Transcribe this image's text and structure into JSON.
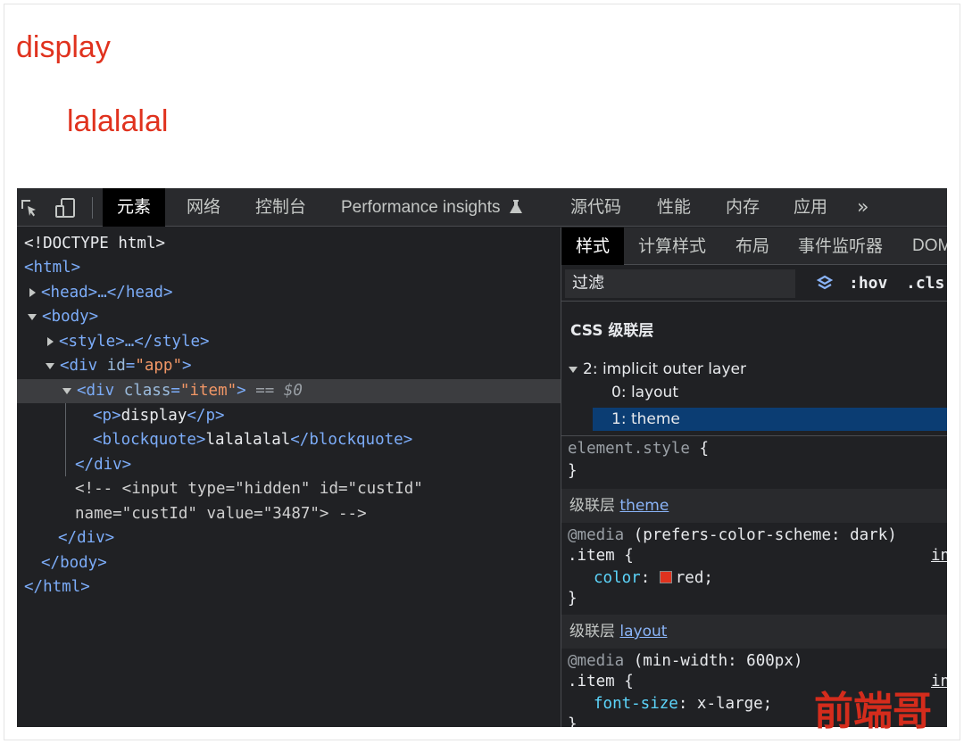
{
  "page": {
    "p_text": "display",
    "blockquote_text": "lalalalal"
  },
  "devtools": {
    "tabs": [
      {
        "label": "元素",
        "active": true
      },
      {
        "label": "网络"
      },
      {
        "label": "控制台"
      },
      {
        "label": "Performance insights"
      },
      {
        "label": "源代码"
      },
      {
        "label": "性能"
      },
      {
        "label": "内存"
      },
      {
        "label": "应用"
      },
      {
        "label": "»"
      }
    ],
    "dom": {
      "doctype": "<!DOCTYPE html>",
      "html_open": "<html>",
      "head": "<head>…</head>",
      "body_open": "<body>",
      "style": "<style>…</style>",
      "div_app_tag": "<div ",
      "div_app_attr": "id",
      "div_app_val": "\"app\"",
      "div_app_end": ">",
      "div_item_tag": "<div ",
      "div_item_attr": "class",
      "div_item_val": "\"item\"",
      "div_item_end": ">",
      "selected_marker": " == $0",
      "p_open": "<p>",
      "p_text": "display",
      "p_close": "</p>",
      "bq_open": "<blockquote>",
      "bq_text": "lalalalal",
      "bq_close": "</blockquote>",
      "div_close_inner": "</div>",
      "comment_line1": "<!-- <input type=\"hidden\" id=\"custId\"",
      "comment_line2": "name=\"custId\" value=\"3487\"> -->",
      "div_close_app": "</div>",
      "body_close": "</body>",
      "html_close": "</html>"
    },
    "styles": {
      "tabs": [
        {
          "label": "样式",
          "active": true
        },
        {
          "label": "计算样式"
        },
        {
          "label": "布局"
        },
        {
          "label": "事件监听器"
        },
        {
          "label": "DOM"
        }
      ],
      "filter_placeholder": "过滤",
      "hov": ":hov",
      "cls": ".cls",
      "layers_title": "CSS 级联层",
      "layers": {
        "outer": "2: implicit outer layer",
        "items": [
          "0: layout",
          "1: theme"
        ],
        "selected": "1: theme"
      },
      "element_style": "element.style",
      "brace_open": " {",
      "brace_close": "}",
      "layer_prefix": "级联层",
      "theme_layer": "theme",
      "theme_media_kw": "@media",
      "theme_media_query": " (prefers-color-scheme: dark)",
      "theme_selector": ".item {",
      "theme_prop": "color",
      "theme_value": "red;",
      "theme_swatch_color": "#e0321e",
      "layout_layer": "layout",
      "layout_media_kw": "@media",
      "layout_media_query": " (min-width: 600px)",
      "layout_selector": ".item {",
      "layout_prop": "font-size",
      "layout_value": "x-large;",
      "src_link": "in"
    }
  },
  "watermark": "前端哥"
}
